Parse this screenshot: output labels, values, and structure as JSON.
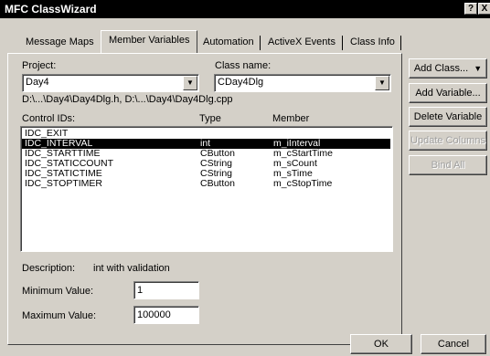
{
  "window": {
    "title": "MFC ClassWizard",
    "help_label": "?",
    "close_label": "X"
  },
  "tabs": [
    {
      "label": "Message Maps"
    },
    {
      "label": "Member Variables"
    },
    {
      "label": "Automation"
    },
    {
      "label": "ActiveX Events"
    },
    {
      "label": "Class Info"
    }
  ],
  "project": {
    "label": "Project:",
    "value": "Day4"
  },
  "class_name": {
    "label": "Class name:",
    "value": "CDay4Dlg"
  },
  "files_path": "D:\\...\\Day4\\Day4Dlg.h, D:\\...\\Day4\\Day4Dlg.cpp",
  "columns": {
    "control_ids": "Control IDs:",
    "type": "Type",
    "member": "Member"
  },
  "rows": [
    {
      "id": "IDC_EXIT",
      "type": "",
      "member": "",
      "selected": false
    },
    {
      "id": "IDC_INTERVAL",
      "type": "int",
      "member": "m_iInterval",
      "selected": true
    },
    {
      "id": "IDC_STARTTIME",
      "type": "CButton",
      "member": "m_cStartTime",
      "selected": false
    },
    {
      "id": "IDC_STATICCOUNT",
      "type": "CString",
      "member": "m_sCount",
      "selected": false
    },
    {
      "id": "IDC_STATICTIME",
      "type": "CString",
      "member": "m_sTime",
      "selected": false
    },
    {
      "id": "IDC_STOPTIMER",
      "type": "CButton",
      "member": "m_cStopTime",
      "selected": false
    }
  ],
  "description": {
    "label": "Description:",
    "value": "int with validation"
  },
  "minimum": {
    "label": "Minimum Value:",
    "value": "1"
  },
  "maximum": {
    "label": "Maximum Value:",
    "value": "100000"
  },
  "buttons": {
    "add_class": "Add Class...",
    "add_variable": "Add Variable...",
    "delete_variable": "Delete Variable",
    "update_columns": "Update Columns",
    "bind_all": "Bind All",
    "ok": "OK",
    "cancel": "Cancel"
  }
}
